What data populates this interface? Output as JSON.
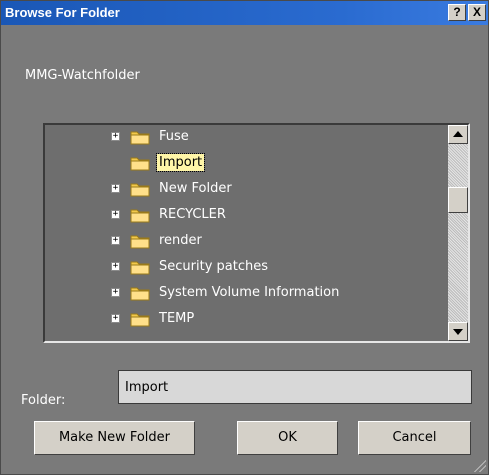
{
  "dialog": {
    "title": "Browse For Folder",
    "help_label": "?",
    "close_label": "X",
    "description": "MMG-Watchfolder"
  },
  "tree": {
    "items": [
      {
        "label": "Fuse",
        "expander": "+",
        "selected": false
      },
      {
        "label": "Import",
        "expander": "",
        "selected": true
      },
      {
        "label": "New Folder",
        "expander": "+",
        "selected": false
      },
      {
        "label": "RECYCLER",
        "expander": "+",
        "selected": false
      },
      {
        "label": "render",
        "expander": "+",
        "selected": false
      },
      {
        "label": "Security patches",
        "expander": "+",
        "selected": false
      },
      {
        "label": "System Volume Information",
        "expander": "+",
        "selected": false
      },
      {
        "label": "TEMP",
        "expander": "+",
        "selected": false
      }
    ]
  },
  "folder_field": {
    "label": "Folder:",
    "value": "Import"
  },
  "buttons": {
    "make_new_folder": "Make New Folder",
    "ok": "OK",
    "cancel": "Cancel"
  },
  "colors": {
    "titlebar": "#1a57b6",
    "dialog_bg": "#7a7a7a",
    "folder_icon": "#f2c94c"
  },
  "icons": {
    "folder": "folder-icon",
    "expander": "plus-box-icon",
    "scroll_up": "arrow-up-icon",
    "scroll_down": "arrow-down-icon"
  }
}
